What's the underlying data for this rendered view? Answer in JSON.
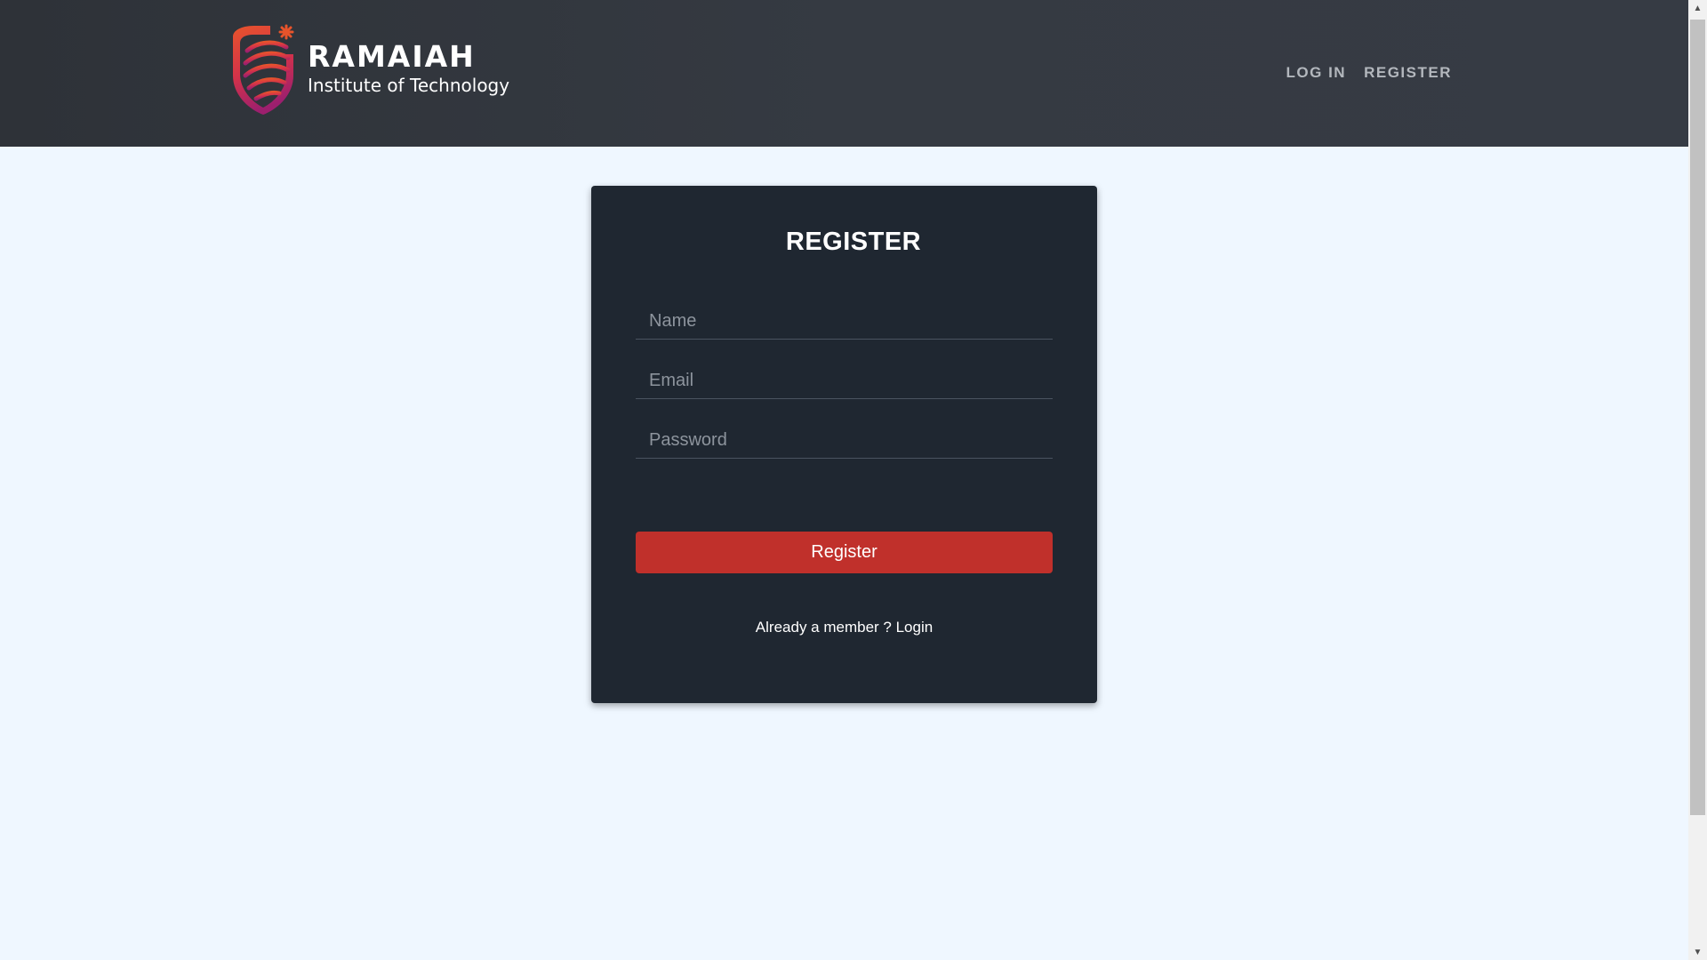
{
  "navbar": {
    "brand_name": "RAMAIAH",
    "brand_subtitle": "Institute of Technology",
    "links": [
      {
        "label": "LOG IN"
      },
      {
        "label": "REGISTER"
      }
    ]
  },
  "form": {
    "title": "REGISTER",
    "name_placeholder": "Name",
    "email_placeholder": "Email",
    "password_placeholder": "Password",
    "submit_label": "Register",
    "member_prefix": "Already a member ? ",
    "login_link": "Login"
  },
  "scrollbar": {
    "up_icon": "triangle-up-icon",
    "down_icon": "triangle-down-icon"
  },
  "colors": {
    "navbar": "#353a42",
    "page_background": "#eff7ff",
    "card": "#1f2731",
    "accent_button": "#c0302b",
    "logo_gradient": [
      "#e8542b",
      "#c8235a",
      "#9c1f6e"
    ]
  }
}
